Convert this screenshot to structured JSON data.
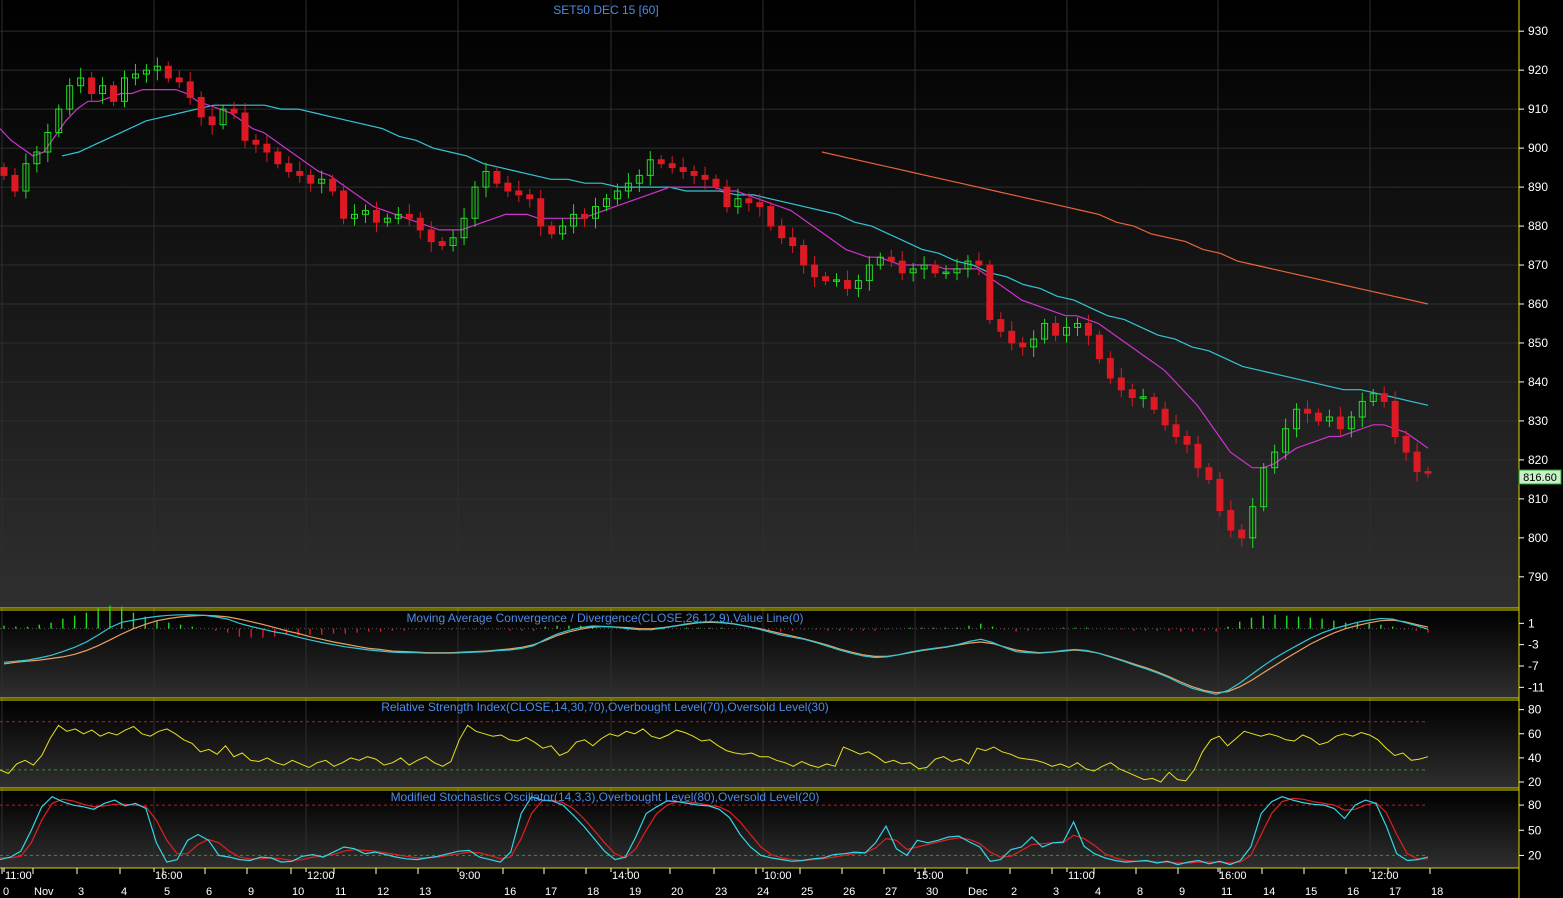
{
  "chart_data": [
    {
      "type": "candlestick",
      "title": "SET50 DEC 15  [60]",
      "ylim": [
        782,
        938
      ],
      "y_ticks": [
        930,
        920,
        910,
        900,
        890,
        880,
        870,
        860,
        850,
        840,
        830,
        820,
        810,
        800,
        790
      ],
      "last_price": "816.60",
      "grid": true,
      "series": [
        {
          "name": "ma-fast",
          "color": "#cc33cc"
        },
        {
          "name": "ma-mid",
          "color": "#33c6d6"
        },
        {
          "name": "ma-slow",
          "color": "#e8643a"
        }
      ],
      "close": [
        893,
        889,
        896,
        899,
        904,
        910,
        916,
        918,
        914,
        916,
        912,
        918,
        919,
        920,
        921,
        918,
        917,
        913,
        908,
        906,
        910,
        909,
        902,
        901,
        899,
        896,
        894,
        893,
        891,
        892,
        889,
        882,
        883,
        884,
        881,
        882,
        883,
        882,
        879,
        876,
        875,
        877,
        882,
        890,
        894,
        891,
        889,
        888,
        887,
        880,
        878,
        880,
        883,
        882,
        885,
        887,
        889,
        891,
        893,
        897,
        896,
        895,
        894,
        893,
        892,
        890,
        885,
        887,
        886,
        885,
        880,
        877,
        875,
        870,
        867,
        866,
        866,
        864,
        866,
        870,
        872,
        871,
        868,
        869,
        870,
        868,
        868,
        869,
        871,
        870,
        856,
        853,
        850,
        849,
        851,
        855,
        852,
        854,
        855,
        852,
        846,
        841,
        838,
        836,
        836,
        833,
        829,
        826,
        824,
        818,
        815,
        807,
        802,
        800,
        808,
        818,
        822,
        828,
        833,
        832,
        830,
        831,
        828,
        831,
        835,
        837,
        835,
        826,
        822,
        817,
        816.6
      ],
      "ma_fast": [
        905,
        902,
        900,
        898,
        899,
        903,
        907,
        910,
        912,
        912,
        913,
        914,
        914,
        915,
        915,
        915,
        915,
        914,
        912,
        911,
        910,
        909,
        907,
        905,
        904,
        902,
        900,
        898,
        896,
        894,
        893,
        891,
        889,
        887,
        885,
        884,
        883,
        882,
        881,
        880,
        879,
        879,
        879,
        880,
        881,
        882,
        883,
        883,
        883,
        882,
        882,
        882,
        882,
        882,
        883,
        884,
        885,
        886,
        887,
        888,
        889,
        890,
        890,
        890,
        890,
        890,
        889,
        889,
        888,
        887,
        886,
        885,
        884,
        882,
        880,
        878,
        876,
        874,
        873,
        872,
        872,
        871,
        870,
        870,
        870,
        870,
        869,
        869,
        869,
        869,
        867,
        865,
        863,
        861,
        860,
        859,
        858,
        857,
        857,
        856,
        855,
        853,
        851,
        849,
        847,
        845,
        843,
        840,
        837,
        834,
        830,
        826,
        822,
        820,
        818,
        818,
        819,
        821,
        823,
        824,
        825,
        826,
        826,
        827,
        828,
        829,
        829,
        828,
        827,
        825,
        823
      ],
      "ma_mid": [
        898,
        899,
        901,
        903,
        905,
        907,
        908,
        909,
        910,
        911,
        911,
        911,
        911,
        910,
        910,
        909,
        908,
        907,
        906,
        905,
        903,
        902,
        900,
        899,
        898,
        896,
        895,
        894,
        893,
        892,
        892,
        891,
        891,
        890,
        890,
        890,
        890,
        889,
        889,
        889,
        888,
        888,
        887,
        886,
        885,
        884,
        883,
        881,
        880,
        878,
        876,
        874,
        873,
        871,
        870,
        868,
        867,
        865,
        864,
        862,
        861,
        859,
        857,
        856,
        854,
        852,
        851,
        849,
        848,
        846,
        844,
        843,
        842,
        841,
        840,
        839,
        838,
        838,
        837,
        836,
        835,
        834
      ],
      "ma_slow": [
        899,
        898,
        897,
        896,
        895,
        894,
        893,
        892,
        891,
        890,
        889,
        888,
        887,
        886,
        885,
        884,
        883,
        881,
        880,
        878,
        877,
        876,
        874,
        873,
        871,
        870,
        869,
        868,
        867,
        866,
        865,
        864,
        863,
        862,
        861,
        860
      ]
    },
    {
      "type": "line",
      "title": "Moving Average Convergence / Divergence(CLOSE,26,12,9),Value Line(0)",
      "ylim": [
        -13,
        3.5
      ],
      "y_ticks": [
        "1",
        "-3",
        "-7",
        "-11"
      ],
      "tick_values": [
        1,
        -3,
        -7,
        -11
      ],
      "series": [
        {
          "name": "macd",
          "color": "#33c6d6"
        },
        {
          "name": "signal",
          "color": "#e8a060"
        },
        {
          "name": "histogram",
          "color": "#22cc22"
        }
      ],
      "macd": [
        -6.3,
        -6.1,
        -5.9,
        -5.5,
        -5.0,
        -4.3,
        -3.5,
        -2.5,
        -1.2,
        0.2,
        1.2,
        1.6,
        2.0,
        2.3,
        2.5,
        2.6,
        2.6,
        2.5,
        2.2,
        1.8,
        1.0,
        0.4,
        -0.1,
        -0.6,
        -1.0,
        -1.6,
        -2.1,
        -2.6,
        -3.0,
        -3.4,
        -3.7,
        -4.0,
        -4.2,
        -4.4,
        -4.5,
        -4.5,
        -4.6,
        -4.6,
        -4.6,
        -4.5,
        -4.4,
        -4.3,
        -4.1,
        -4.0,
        -3.7,
        -3.2,
        -2.0,
        -1.0,
        -0.3,
        0.2,
        0.5,
        0.4,
        0.3,
        0.0,
        -0.2,
        -0.2,
        0.1,
        0.5,
        0.9,
        1.2,
        1.3,
        1.2,
        0.9,
        0.5,
        0.0,
        -0.6,
        -1.2,
        -1.6,
        -2.0,
        -2.6,
        -3.3,
        -4.0,
        -4.6,
        -5.1,
        -5.4,
        -5.3,
        -4.9,
        -4.4,
        -4.0,
        -3.7,
        -3.4,
        -3.0,
        -2.4,
        -2.0,
        -2.6,
        -3.5,
        -4.3,
        -4.5,
        -4.6,
        -4.4,
        -4.1,
        -3.9,
        -4.1,
        -4.6,
        -5.3,
        -6.0,
        -6.8,
        -7.5,
        -8.3,
        -9.2,
        -10.3,
        -11.2,
        -11.8,
        -12.3,
        -11.6,
        -10.2,
        -8.6,
        -7.0,
        -5.5,
        -4.2,
        -3.0,
        -1.8,
        -0.8,
        0.0,
        0.6,
        1.2,
        1.6,
        1.9,
        1.8,
        1.2,
        0.6,
        -0.1
      ],
      "signal": [
        -6.6,
        -6.3,
        -6.1,
        -5.9,
        -5.6,
        -5.3,
        -4.8,
        -4.1,
        -3.2,
        -2.1,
        -1.0,
        0.0,
        0.8,
        1.5,
        1.9,
        2.2,
        2.4,
        2.5,
        2.4,
        2.2,
        1.8,
        1.3,
        0.8,
        0.2,
        -0.4,
        -0.9,
        -1.5,
        -2.0,
        -2.5,
        -2.9,
        -3.3,
        -3.7,
        -3.9,
        -4.2,
        -4.3,
        -4.4,
        -4.5,
        -4.5,
        -4.5,
        -4.4,
        -4.3,
        -4.2,
        -4.0,
        -3.8,
        -3.5,
        -3.0,
        -2.2,
        -1.3,
        -0.6,
        -0.1,
        0.3,
        0.4,
        0.3,
        0.2,
        0.0,
        0.0,
        0.2,
        0.5,
        0.8,
        1.1,
        1.2,
        1.1,
        0.9,
        0.5,
        0.1,
        -0.4,
        -0.9,
        -1.4,
        -1.9,
        -2.5,
        -3.1,
        -3.8,
        -4.4,
        -4.9,
        -5.2,
        -5.2,
        -4.9,
        -4.5,
        -4.1,
        -3.8,
        -3.5,
        -3.1,
        -2.7,
        -2.5,
        -2.8,
        -3.4,
        -4.0,
        -4.3,
        -4.5,
        -4.4,
        -4.2,
        -4.0,
        -4.2,
        -4.6,
        -5.2,
        -5.9,
        -6.6,
        -7.3,
        -8.1,
        -9.0,
        -10.0,
        -10.9,
        -11.6,
        -12.0,
        -11.8,
        -10.9,
        -9.7,
        -8.3,
        -6.9,
        -5.5,
        -4.2,
        -2.9,
        -1.8,
        -0.8,
        0.0,
        0.6,
        1.1,
        1.5,
        1.6,
        1.3,
        0.8,
        0.3
      ]
    },
    {
      "type": "line",
      "title": "Relative Strength Index(CLOSE,14,30,70),Overbought Level(70),Oversold Level(30)",
      "ylim": [
        15,
        88
      ],
      "y_ticks": [
        "80",
        "60",
        "40",
        "20"
      ],
      "tick_values": [
        80,
        60,
        40,
        20
      ],
      "overbought": 70,
      "oversold": 30,
      "series": [
        {
          "name": "rsi",
          "color": "#e8e020"
        }
      ],
      "values": [
        30,
        27,
        35,
        38,
        34,
        42,
        56,
        67,
        62,
        64,
        60,
        63,
        58,
        61,
        59,
        63,
        66,
        60,
        58,
        62,
        64,
        60,
        55,
        52,
        45,
        47,
        43,
        50,
        41,
        44,
        38,
        37,
        40,
        36,
        34,
        38,
        35,
        32,
        36,
        38,
        33,
        36,
        40,
        38,
        41,
        39,
        34,
        36,
        40,
        34,
        38,
        41,
        36,
        33,
        37,
        55,
        67,
        62,
        60,
        58,
        59,
        55,
        54,
        57,
        53,
        48,
        50,
        42,
        45,
        53,
        55,
        50,
        56,
        60,
        58,
        62,
        60,
        64,
        58,
        56,
        59,
        63,
        61,
        58,
        54,
        55,
        50,
        46,
        44,
        43,
        44,
        41,
        41,
        38,
        36,
        33,
        37,
        34,
        32,
        35,
        33,
        49,
        46,
        43,
        45,
        41,
        36,
        38,
        35,
        36,
        31,
        32,
        39,
        41,
        37,
        39,
        35,
        48,
        46,
        49,
        45,
        43,
        40,
        39,
        38,
        36,
        33,
        35,
        32,
        36,
        31,
        29,
        33,
        36,
        31,
        28,
        25,
        22,
        23,
        20,
        28,
        22,
        21,
        30,
        45,
        55,
        58,
        50,
        56,
        62,
        60,
        58,
        60,
        58,
        55,
        54,
        59,
        56,
        51,
        53,
        58,
        60,
        58,
        61,
        59,
        55,
        48,
        42,
        44,
        38,
        39,
        41
      ]
    },
    {
      "type": "line",
      "title": "Modified Stochastics Oscillator(14,3,3),Overbought Level(80),Oversold Level(20)",
      "ylim": [
        5,
        98
      ],
      "y_ticks": [
        "80",
        "50",
        "20"
      ],
      "tick_values": [
        80,
        50,
        20
      ],
      "overbought": 80,
      "oversold": 20,
      "series": [
        {
          "name": "%K",
          "color": "#33d6e8"
        },
        {
          "name": "%D",
          "color": "#e02020"
        }
      ],
      "k": [
        15,
        18,
        25,
        50,
        78,
        90,
        84,
        80,
        78,
        75,
        82,
        86,
        79,
        82,
        76,
        35,
        12,
        15,
        38,
        45,
        38,
        20,
        18,
        15,
        14,
        18,
        17,
        12,
        13,
        19,
        21,
        18,
        24,
        30,
        28,
        22,
        24,
        21,
        18,
        16,
        15,
        17,
        19,
        22,
        25,
        26,
        18,
        15,
        12,
        24,
        70,
        90,
        86,
        85,
        80,
        68,
        55,
        40,
        25,
        15,
        18,
        42,
        70,
        78,
        85,
        84,
        82,
        80,
        79,
        75,
        65,
        45,
        30,
        20,
        17,
        15,
        13,
        14,
        16,
        17,
        21,
        22,
        24,
        23,
        35,
        55,
        28,
        20,
        38,
        35,
        38,
        42,
        43,
        36,
        30,
        13,
        15,
        27,
        30,
        42,
        30,
        35,
        36,
        60,
        31,
        22,
        17,
        14,
        12,
        13,
        14,
        11,
        13,
        9,
        12,
        14,
        10,
        13,
        9,
        14,
        30,
        70,
        84,
        90,
        86,
        83,
        81,
        80,
        76,
        64,
        80,
        86,
        82,
        55,
        22,
        14,
        15,
        18
      ],
      "d": [
        17,
        17,
        19,
        35,
        62,
        82,
        87,
        85,
        81,
        78,
        79,
        81,
        81,
        80,
        78,
        62,
        38,
        22,
        22,
        33,
        39,
        35,
        25,
        18,
        16,
        16,
        17,
        16,
        14,
        15,
        18,
        19,
        21,
        25,
        27,
        26,
        25,
        23,
        21,
        19,
        17,
        17,
        18,
        20,
        22,
        24,
        23,
        20,
        16,
        18,
        40,
        70,
        85,
        86,
        83,
        76,
        64,
        50,
        35,
        22,
        17,
        28,
        50,
        70,
        80,
        84,
        84,
        82,
        80,
        78,
        72,
        60,
        45,
        30,
        21,
        17,
        15,
        14,
        15,
        16,
        18,
        20,
        22,
        23,
        29,
        40,
        38,
        27,
        30,
        33,
        36,
        39,
        41,
        39,
        34,
        24,
        18,
        19,
        26,
        33,
        34,
        35,
        35,
        44,
        40,
        32,
        22,
        17,
        14,
        13,
        13,
        12,
        12,
        11,
        11,
        12,
        12,
        12,
        11,
        12,
        20,
        45,
        70,
        84,
        88,
        87,
        84,
        82,
        80,
        74,
        75,
        80,
        83,
        71,
        45,
        22,
        16,
        16
      ]
    },
    {
      "type": "time-axis",
      "labels": [
        {
          "text": "0"
        },
        {
          "text": "11:00"
        },
        {
          "text": "Nov"
        },
        {
          "text": "3"
        },
        {
          "text": "4"
        },
        {
          "text": "16:00"
        },
        {
          "text": "5"
        },
        {
          "text": "6"
        },
        {
          "text": "9"
        },
        {
          "text": "10"
        },
        {
          "text": "12:00"
        },
        {
          "text": "11"
        },
        {
          "text": "12"
        },
        {
          "text": "13"
        },
        {
          "text": "9:00"
        },
        {
          "text": "16"
        },
        {
          "text": "17"
        },
        {
          "text": "18"
        },
        {
          "text": "19"
        },
        {
          "text": "14:00"
        },
        {
          "text": "20"
        },
        {
          "text": "23"
        },
        {
          "text": "24"
        },
        {
          "text": "10:00"
        },
        {
          "text": "25"
        },
        {
          "text": "26"
        },
        {
          "text": "27"
        },
        {
          "text": "30"
        },
        {
          "text": "15:00"
        },
        {
          "text": "Dec"
        },
        {
          "text": "2"
        },
        {
          "text": "3"
        },
        {
          "text": "11:00"
        },
        {
          "text": "4"
        },
        {
          "text": "8"
        },
        {
          "text": "9"
        },
        {
          "text": "11"
        },
        {
          "text": "16:00"
        },
        {
          "text": "14"
        },
        {
          "text": "15"
        },
        {
          "text": "16"
        },
        {
          "text": "17"
        },
        {
          "text": "12:00"
        },
        {
          "text": "18"
        }
      ]
    }
  ],
  "colors": {
    "background": "#000000",
    "grid": "#2e2e2e",
    "panel_border": "#d8d800",
    "title": "#4c8ce8",
    "axis_text": "#ffffff",
    "bull": "#22dd22",
    "bear": "#dd1a24",
    "overbought_line": "#b02020",
    "oversold_line": "#20a020"
  }
}
